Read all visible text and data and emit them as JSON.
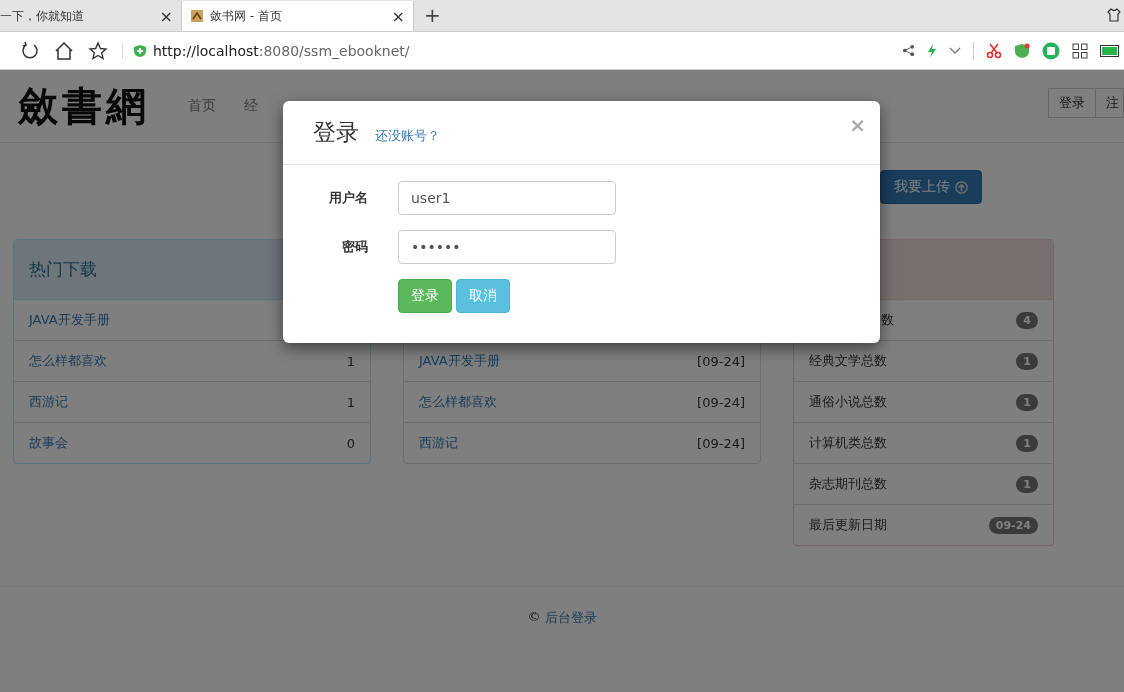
{
  "browser": {
    "tabs": [
      {
        "title": "一下，你就知道",
        "selected": false,
        "close": "×"
      },
      {
        "title": "敛书网 - 首页",
        "selected": true,
        "close": "×"
      }
    ],
    "new_tab": "+",
    "address": {
      "url_host": "http://localhost",
      "url_rest": ":8080/ssm_ebooknet/"
    }
  },
  "page": {
    "logo": "斂書網",
    "nav": [
      "首页",
      "经"
    ],
    "account_buttons": [
      "登录",
      "注"
    ],
    "upload_button": "我要上传",
    "hot_panel": {
      "title": "热门下载",
      "rows": [
        {
          "name": "JAVA开发手册"
        },
        {
          "name": "怎么样都喜欢",
          "count": "1"
        },
        {
          "name": "西游记",
          "count": "1"
        },
        {
          "name": "故事会",
          "count": "0"
        }
      ]
    },
    "latest_panel": {
      "rows": [
        {
          "name": "JAVA开发手册",
          "date": "[09-24]"
        },
        {
          "name": "怎么样都喜欢",
          "date": "[09-24]"
        },
        {
          "name": "西游记",
          "date": "[09-24]"
        }
      ]
    },
    "stats_panel": {
      "rows": [
        {
          "label": "数",
          "badge": "4"
        },
        {
          "label": "经典文学总数",
          "badge": "1"
        },
        {
          "label": "通俗小说总数",
          "badge": "1"
        },
        {
          "label": "计算机类总数",
          "badge": "1"
        },
        {
          "label": "杂志期刊总数",
          "badge": "1"
        },
        {
          "label": "最后更新日期",
          "badge": "09-24"
        }
      ]
    },
    "footer": {
      "symbol": "©",
      "link": "后台登录"
    }
  },
  "modal": {
    "title": "登录",
    "register_link": "还没账号？",
    "close": "×",
    "fields": [
      {
        "label": "用户名",
        "value": "user1"
      },
      {
        "label": "密码",
        "value": "••••••"
      }
    ],
    "buttons": [
      {
        "label": "登录",
        "kind": "primary"
      },
      {
        "label": "取消",
        "kind": "cancel"
      }
    ]
  }
}
